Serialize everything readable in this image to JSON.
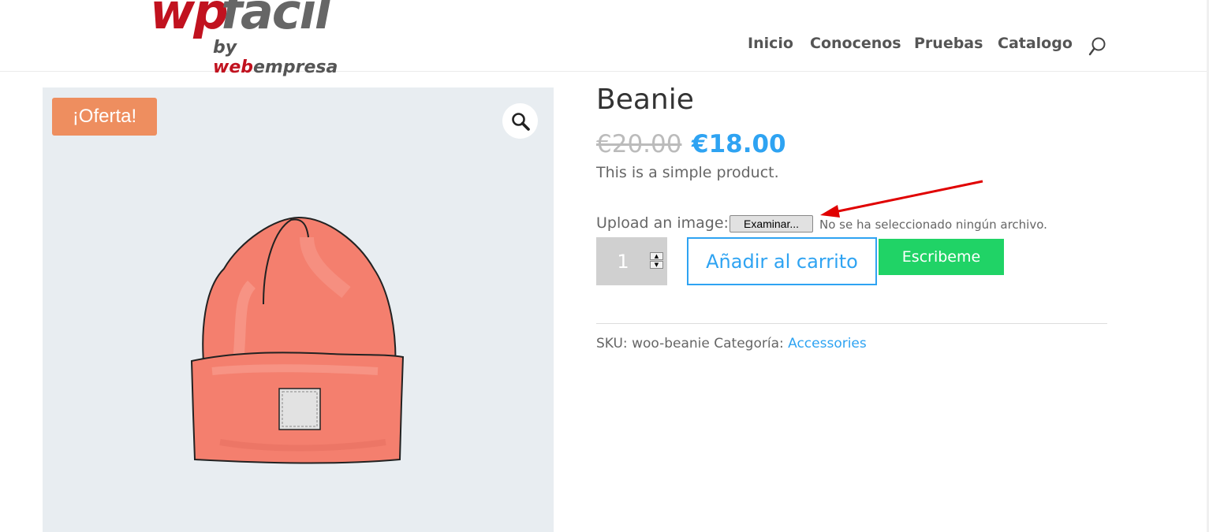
{
  "header": {
    "logo": {
      "main_red": "wp",
      "main_gray": "fácil",
      "sub_by": "by ",
      "sub_web": "web",
      "sub_rest": "empresa"
    },
    "nav": [
      {
        "label": "Inicio"
      },
      {
        "label": "Conocenos"
      },
      {
        "label": "Pruebas"
      },
      {
        "label": "Catalogo"
      }
    ],
    "search_icon": "search-icon"
  },
  "gallery": {
    "sale_badge": "¡Oferta!",
    "zoom_icon": "magnifier-icon",
    "image": "beanie-illustration"
  },
  "product": {
    "title": "Beanie",
    "old_price": "€20.00",
    "new_price": "€18.00",
    "short_description": "This is a simple product.",
    "upload": {
      "label": "Upload an image:",
      "button": "Examinar...",
      "status": "No se ha seleccionado ningún archivo."
    },
    "quantity": "1",
    "add_to_cart": "Añadir al carrito",
    "contact_button": "Escribeme",
    "meta": {
      "sku_label": "SKU:",
      "sku": "woo-beanie",
      "category_label": "Categoría:",
      "category": "Accessories"
    }
  },
  "colors": {
    "accent": "#2ea3f2",
    "sale": "#ee8e5f",
    "whatsapp": "#20d366",
    "annotation_arrow": "#e00000"
  }
}
